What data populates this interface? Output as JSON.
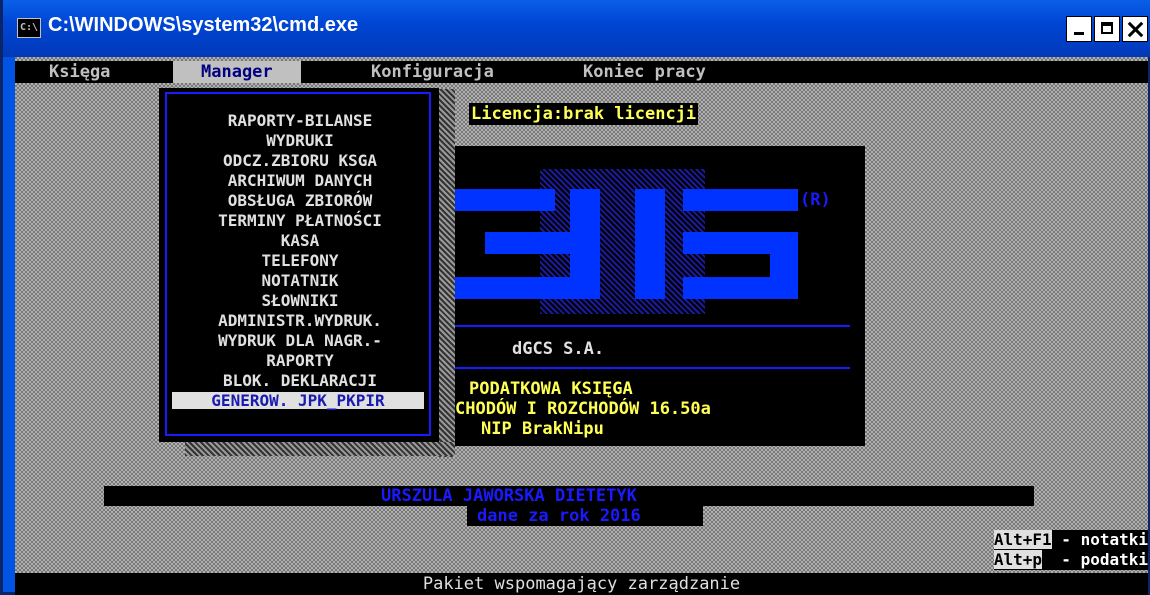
{
  "window": {
    "title": "C:\\WINDOWS\\system32\\cmd.exe",
    "icon": "C:\\"
  },
  "menubar": {
    "items": [
      "Księga",
      "Manager",
      "Konfiguracja",
      "Koniec pracy"
    ],
    "active": "Manager"
  },
  "dropdown": {
    "items": [
      "RAPORTY-BILANSE",
      "WYDRUKI",
      "ODCZ.ZBIORU KSGA",
      "ARCHIWUM DANYCH",
      "OBSŁUGA ZBIORÓW",
      "TERMINY PŁATNOŚCI",
      "KASA",
      "TELEFONY",
      "NOTATNIK",
      "SŁOWNIKI",
      "ADMINISTR.WYDRUK.",
      "WYDRUK DLA NAGR.-",
      "RAPORTY",
      "BLOK. DEKLARACJI",
      "GENEROW. JPK_PKPIR"
    ],
    "selected": "GENEROW. JPK_PKPIR"
  },
  "license": "Licencja:brak licencji",
  "logo": {
    "registered": "(R)"
  },
  "company": "dGCS S.A.",
  "product": {
    "line1": "PODATKOWA   KSIĘGA",
    "line2": "CHODÓW I ROZCHODÓW 16.50a",
    "line3": "NIP BrakNipu"
  },
  "owner": {
    "name": "URSZULA JAWORSKA DIETETYK",
    "year_line": "dane za rok 2016"
  },
  "hints": [
    {
      "key": "Alt+F1",
      "label": " - notatki"
    },
    {
      "key": "Alt+p",
      "label": "  - podatki"
    }
  ],
  "status": "Pakiet wspomagający zarządzanie",
  "colors": {
    "menu_selected_text": "#000080",
    "console_yellow": "#ffff55",
    "logo_blue": "#0033ff"
  }
}
